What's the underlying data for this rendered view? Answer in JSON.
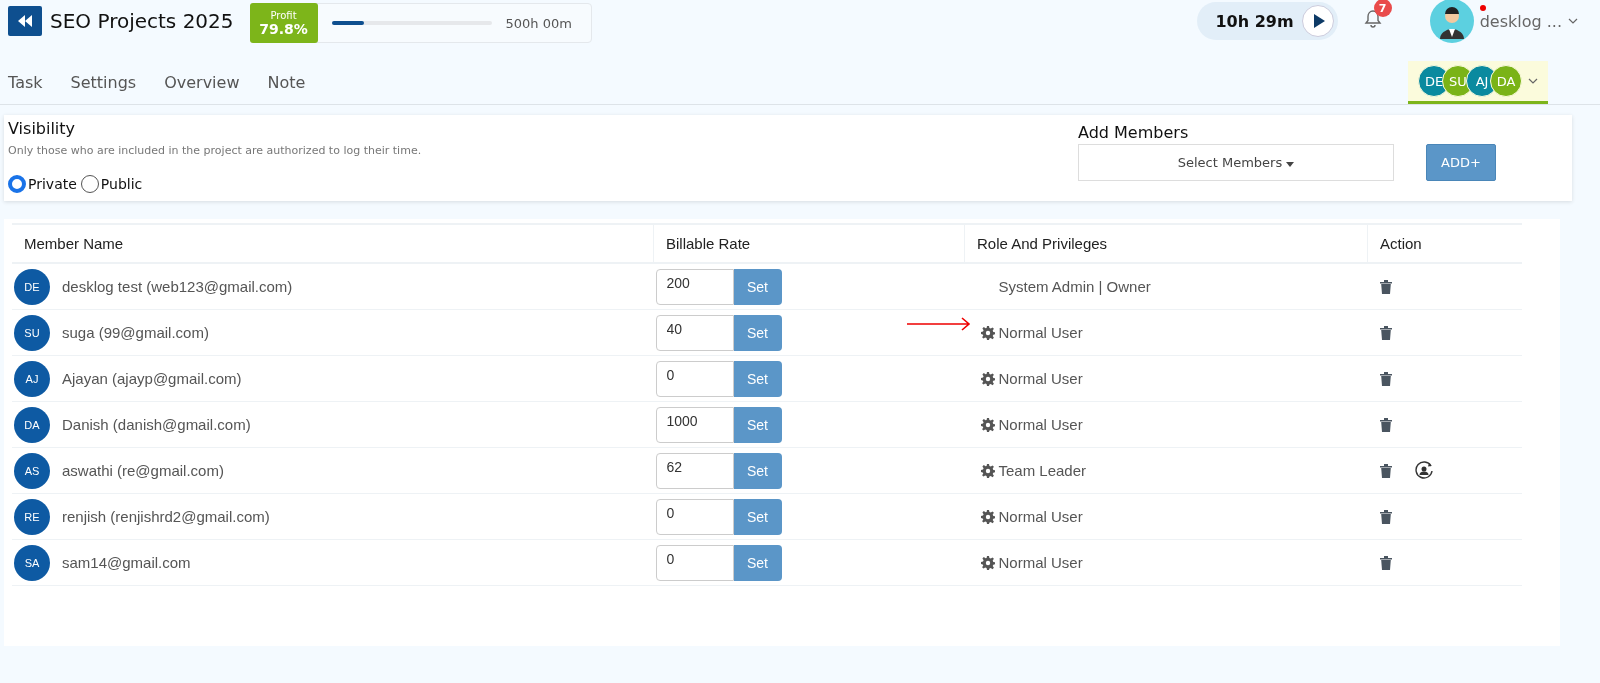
{
  "header": {
    "title": "SEO Projects 2025",
    "profit": {
      "label": "Profit",
      "value": "79.8%"
    },
    "budget": {
      "level": 0.2,
      "total": "500h 00m"
    },
    "timer": "10h 29m",
    "notifications": "7",
    "user": {
      "name": "desklog ...",
      "online": true
    }
  },
  "tabs": [
    {
      "label": "Task"
    },
    {
      "label": "Settings"
    },
    {
      "label": "Overview"
    },
    {
      "label": "Note"
    }
  ],
  "team": [
    {
      "initials": "DE",
      "color": "#0a8a9f"
    },
    {
      "initials": "SU",
      "color": "#7ab317"
    },
    {
      "initials": "AJ",
      "color": "#0a8a9f"
    },
    {
      "initials": "DA",
      "color": "#7ab317"
    }
  ],
  "visibility": {
    "title": "Visibility",
    "description": "Only those who are included in the project are authorized to log their time.",
    "options": [
      {
        "label": "Private",
        "selected": true
      },
      {
        "label": "Public",
        "selected": false
      }
    ]
  },
  "add_members": {
    "title": "Add Members",
    "select": "Select Members",
    "button": "ADD+"
  },
  "table": {
    "columns": [
      "Member Name",
      "Billable Rate",
      "Role And Privileges",
      "Action"
    ],
    "rows": [
      {
        "initials": "DE",
        "name": "desklog test (web123@gmail.com)",
        "rate": "200",
        "set": "Set",
        "role": "System Admin | Owner",
        "editable": false,
        "reassign": false,
        "pointer": false
      },
      {
        "initials": "SU",
        "name": "suga (99@gmail.com)",
        "rate": "40",
        "set": "Set",
        "role": "Normal User",
        "editable": true,
        "reassign": false,
        "pointer": true
      },
      {
        "initials": "AJ",
        "name": "Ajayan (ajayp@gmail.com)",
        "rate": "0",
        "set": "Set",
        "role": "Normal User",
        "editable": true,
        "reassign": false,
        "pointer": false
      },
      {
        "initials": "DA",
        "name": "Danish (danish@gmail.com)",
        "rate": "1000",
        "set": "Set",
        "role": "Normal User",
        "editable": true,
        "reassign": false,
        "pointer": false
      },
      {
        "initials": "AS",
        "name": "aswathi (re@gmail.com)",
        "rate": "62",
        "set": "Set",
        "role": "Team Leader",
        "editable": true,
        "reassign": true,
        "pointer": false
      },
      {
        "initials": "RE",
        "name": "renjish (renjishrd2@gmail.com)",
        "rate": "0",
        "set": "Set",
        "role": "Normal User",
        "editable": true,
        "reassign": false,
        "pointer": false
      },
      {
        "initials": "SA",
        "name": "sam14@gmail.com",
        "rate": "0",
        "set": "Set",
        "role": "Normal User",
        "editable": true,
        "reassign": false,
        "pointer": false
      }
    ]
  }
}
